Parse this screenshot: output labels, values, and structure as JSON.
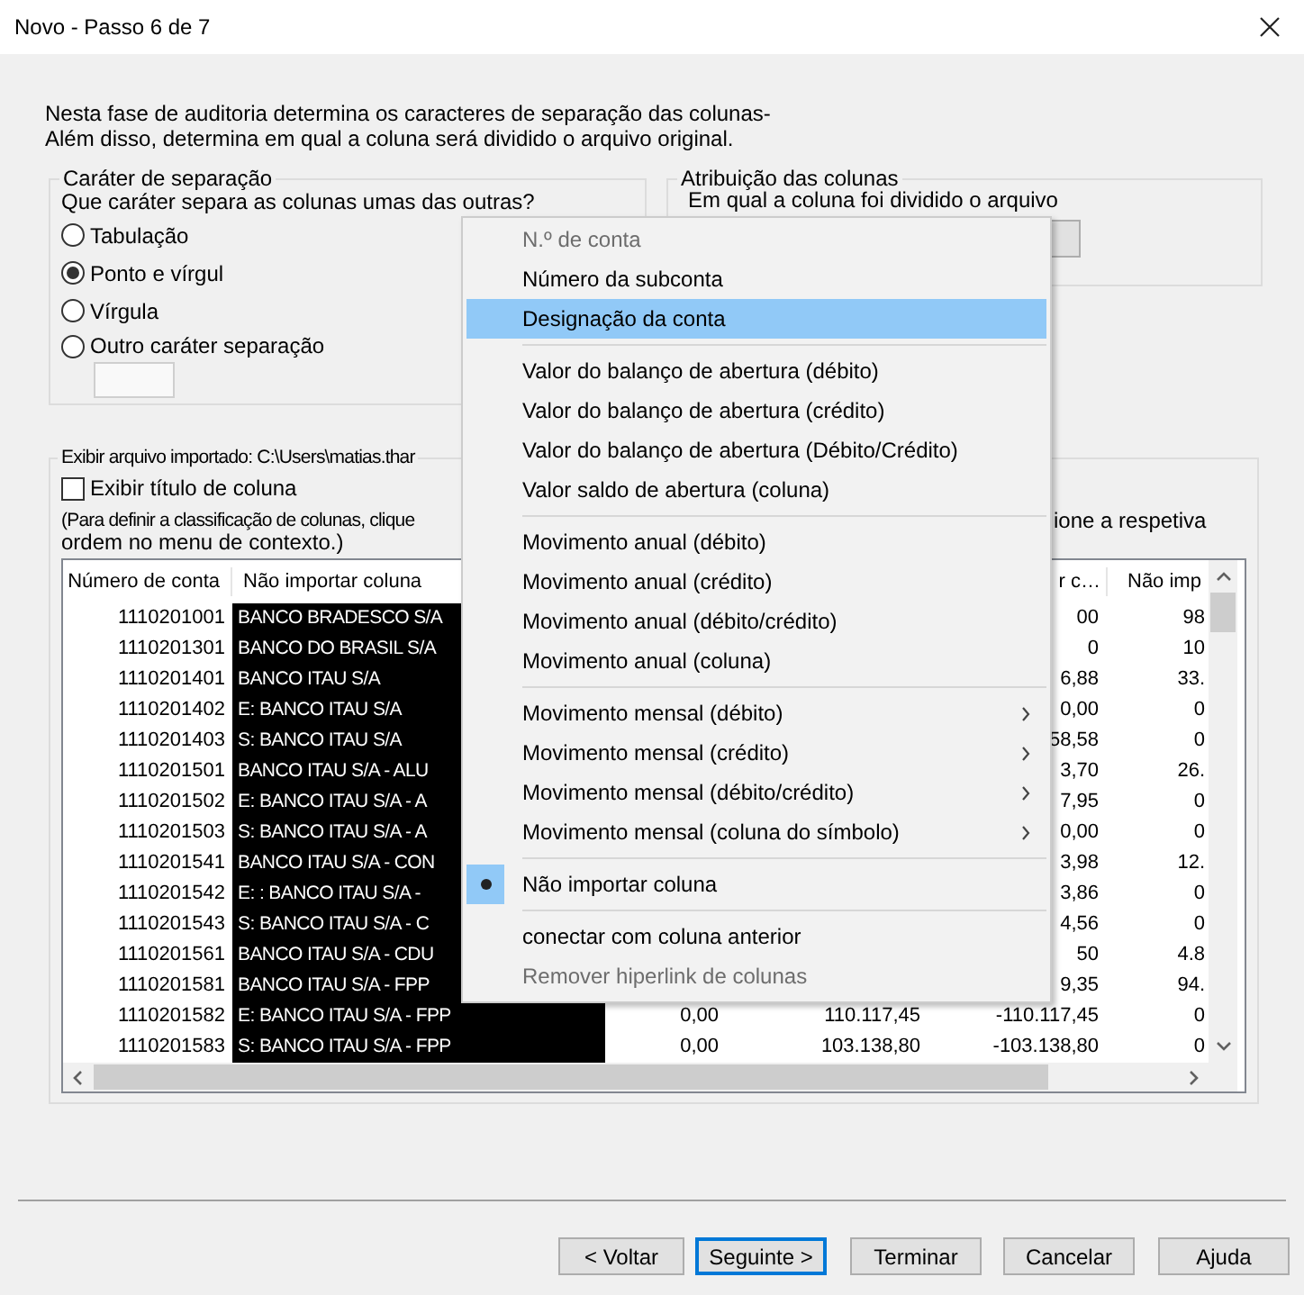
{
  "window": {
    "title": "Novo - Passo 6 de 7"
  },
  "intro": [
    "Nesta fase de auditoria determina os caracteres de separação das colunas-",
    "Além disso, determina em qual a coluna será dividido o arquivo original."
  ],
  "separator_group": {
    "legend": "Caráter de separação",
    "question": "Que caráter separa as colunas umas das outras?",
    "options": [
      {
        "label": "Tabulação",
        "selected": false
      },
      {
        "label": "Ponto e vírgul",
        "selected": true
      },
      {
        "label": "Vírgula",
        "selected": false
      },
      {
        "label": "Outro caráter separação",
        "selected": false
      }
    ]
  },
  "assignment_group": {
    "legend": "Atribuição das colunas",
    "text": "Em qual a coluna foi dividido o arquivo"
  },
  "import_group": {
    "legend": "Exibir arquivo importado: C:\\Users\\matias.thar",
    "show_titles": {
      "label": "Exibir título de coluna",
      "checked": false
    },
    "hint_left": "(Para definir a classificação de colunas, clique",
    "hint_right": "ione a respetiva",
    "hint_line2": "ordem no menu de contexto.)",
    "table": {
      "columns": [
        "Número de conta",
        "Não importar coluna",
        null,
        null,
        "r c…",
        "Não imp"
      ],
      "rows": [
        [
          "1110201001",
          "BANCO BRADESCO S/A",
          null,
          null,
          "00",
          "98"
        ],
        [
          "1110201301",
          "BANCO DO BRASIL S/A",
          null,
          null,
          "0",
          "10"
        ],
        [
          "1110201401",
          "BANCO ITAU S/A",
          null,
          null,
          "6,88",
          "33."
        ],
        [
          "1110201402",
          "E: BANCO ITAU S/A",
          null,
          null,
          "0,00",
          "0"
        ],
        [
          "1110201403",
          "S: BANCO ITAU S/A",
          null,
          null,
          "58,58",
          "0"
        ],
        [
          "1110201501",
          "BANCO ITAU S/A - ALU",
          null,
          null,
          "3,70",
          "26."
        ],
        [
          "1110201502",
          "E: BANCO ITAU S/A - A",
          null,
          null,
          "7,95",
          "0"
        ],
        [
          "1110201503",
          "S: BANCO ITAU S/A - A",
          null,
          null,
          "0,00",
          "0"
        ],
        [
          "1110201541",
          "BANCO ITAU S/A - CON",
          null,
          null,
          "3,98",
          "12."
        ],
        [
          "1110201542",
          "E: : BANCO ITAU S/A -",
          null,
          null,
          "3,86",
          "0"
        ],
        [
          "1110201543",
          "S: BANCO ITAU S/A - C",
          null,
          null,
          "4,56",
          "0"
        ],
        [
          "1110201561",
          "BANCO ITAU S/A - CDU",
          null,
          null,
          "50",
          "4.8"
        ],
        [
          "1110201581",
          "BANCO ITAU S/A - FPP",
          null,
          null,
          "9,35",
          "94."
        ],
        [
          "1110201582",
          "E: BANCO ITAU S/A - FPP",
          "0,00",
          "110.117,45",
          "-110.117,45",
          "0"
        ],
        [
          "1110201583",
          "S: BANCO ITAU S/A - FPP",
          "0,00",
          "103.138,80",
          "-103.138,80",
          "0"
        ]
      ]
    }
  },
  "context_menu": {
    "items": [
      {
        "kind": "item",
        "label": "N.º de conta",
        "disabled": true,
        "selected": false,
        "checked": false,
        "submenu": false
      },
      {
        "kind": "item",
        "label": "Número da subconta",
        "disabled": false,
        "selected": false,
        "checked": false,
        "submenu": false
      },
      {
        "kind": "item",
        "label": "Designação da conta",
        "disabled": false,
        "selected": true,
        "checked": false,
        "submenu": false
      },
      {
        "kind": "separator"
      },
      {
        "kind": "item",
        "label": "Valor do balanço de abertura (débito)",
        "disabled": false,
        "selected": false,
        "checked": false,
        "submenu": false
      },
      {
        "kind": "item",
        "label": "Valor do balanço de abertura (crédito)",
        "disabled": false,
        "selected": false,
        "checked": false,
        "submenu": false
      },
      {
        "kind": "item",
        "label": "Valor do balanço de abertura (Débito/Crédito)",
        "disabled": false,
        "selected": false,
        "checked": false,
        "submenu": false
      },
      {
        "kind": "item",
        "label": "Valor saldo de abertura (coluna)",
        "disabled": false,
        "selected": false,
        "checked": false,
        "submenu": false
      },
      {
        "kind": "separator"
      },
      {
        "kind": "item",
        "label": "Movimento anual (débito)",
        "disabled": false,
        "selected": false,
        "checked": false,
        "submenu": false
      },
      {
        "kind": "item",
        "label": "Movimento anual (crédito)",
        "disabled": false,
        "selected": false,
        "checked": false,
        "submenu": false
      },
      {
        "kind": "item",
        "label": "Movimento anual (débito/crédito)",
        "disabled": false,
        "selected": false,
        "checked": false,
        "submenu": false
      },
      {
        "kind": "item",
        "label": "Movimento anual (coluna)",
        "disabled": false,
        "selected": false,
        "checked": false,
        "submenu": false
      },
      {
        "kind": "separator"
      },
      {
        "kind": "item",
        "label": "Movimento mensal (débito)",
        "disabled": false,
        "selected": false,
        "checked": false,
        "submenu": true
      },
      {
        "kind": "item",
        "label": "Movimento mensal (crédito)",
        "disabled": false,
        "selected": false,
        "checked": false,
        "submenu": true
      },
      {
        "kind": "item",
        "label": "Movimento mensal (débito/crédito)",
        "disabled": false,
        "selected": false,
        "checked": false,
        "submenu": true
      },
      {
        "kind": "item",
        "label": "Movimento mensal (coluna do símbolo)",
        "disabled": false,
        "selected": false,
        "checked": false,
        "submenu": true
      },
      {
        "kind": "separator"
      },
      {
        "kind": "item",
        "label": "Não importar coluna",
        "disabled": false,
        "selected": false,
        "checked": true,
        "submenu": false
      },
      {
        "kind": "separator"
      },
      {
        "kind": "item",
        "label": "conectar com coluna anterior",
        "disabled": false,
        "selected": false,
        "checked": false,
        "submenu": false
      },
      {
        "kind": "item",
        "label": "Remover hiperlink de colunas",
        "disabled": true,
        "selected": false,
        "checked": false,
        "submenu": false
      }
    ]
  },
  "buttons": [
    {
      "label": "< Voltar",
      "focused": false
    },
    {
      "label": "Seguinte >",
      "focused": true
    },
    {
      "label": "Terminar",
      "focused": false
    },
    {
      "label": "Cancelar",
      "focused": false
    },
    {
      "label": "Ajuda",
      "focused": false
    }
  ]
}
